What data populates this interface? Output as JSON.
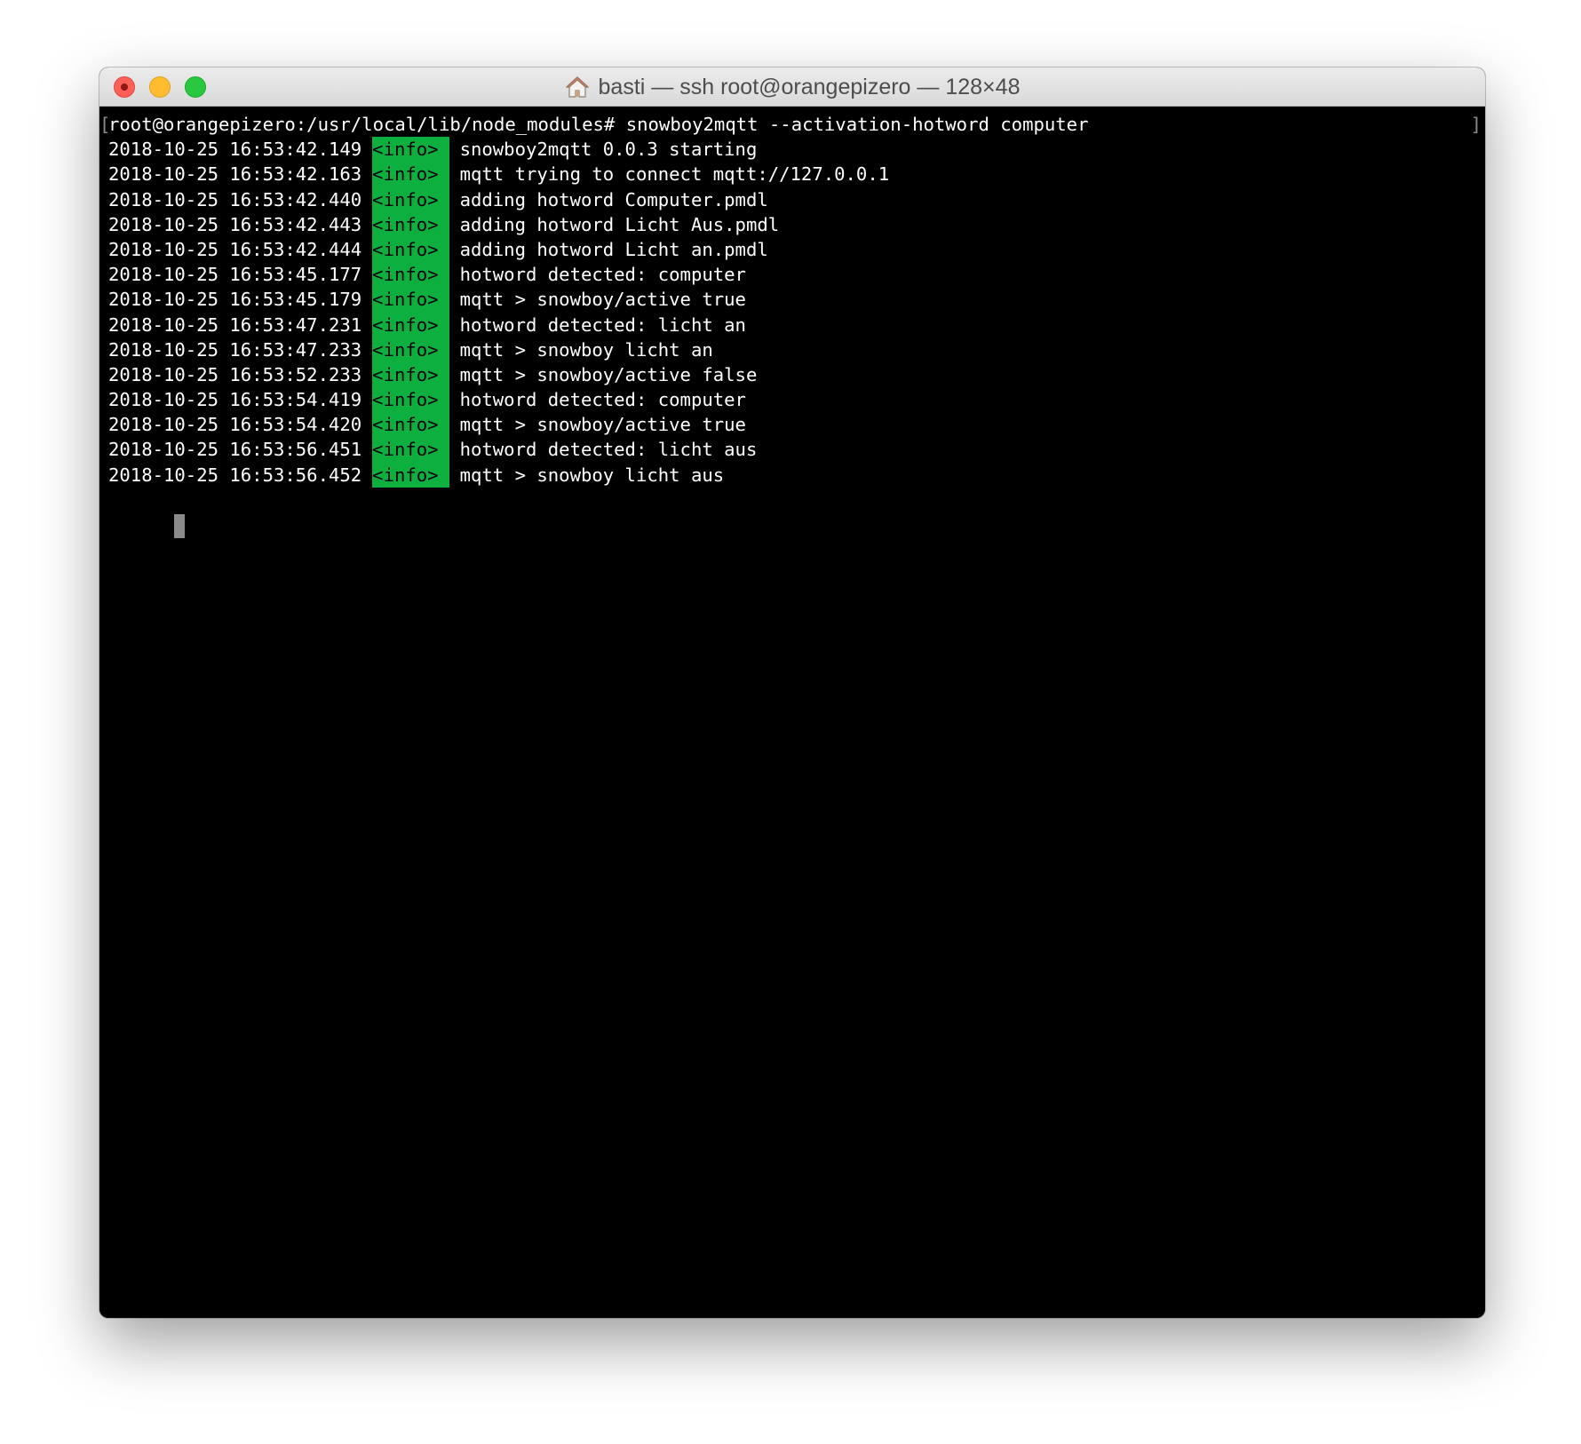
{
  "window": {
    "title": "basti — ssh root@orangepizero — 128×48"
  },
  "terminal": {
    "prompt": "root@orangepizero:/usr/local/lib/node_modules# snowboy2mqtt --activation-hotword computer",
    "bracket_left": "[",
    "bracket_right": "]",
    "lines": [
      {
        "ts": "2018-10-25 16:53:42.149",
        "level": "<info>",
        "msg": "snowboy2mqtt 0.0.3 starting"
      },
      {
        "ts": "2018-10-25 16:53:42.163",
        "level": "<info>",
        "msg": "mqtt trying to connect mqtt://127.0.0.1"
      },
      {
        "ts": "2018-10-25 16:53:42.440",
        "level": "<info>",
        "msg": "adding hotword Computer.pmdl"
      },
      {
        "ts": "2018-10-25 16:53:42.443",
        "level": "<info>",
        "msg": "adding hotword Licht Aus.pmdl"
      },
      {
        "ts": "2018-10-25 16:53:42.444",
        "level": "<info>",
        "msg": "adding hotword Licht an.pmdl"
      },
      {
        "ts": "2018-10-25 16:53:45.177",
        "level": "<info>",
        "msg": "hotword detected: computer"
      },
      {
        "ts": "2018-10-25 16:53:45.179",
        "level": "<info>",
        "msg": "mqtt > snowboy/active true"
      },
      {
        "ts": "2018-10-25 16:53:47.231",
        "level": "<info>",
        "msg": "hotword detected: licht an"
      },
      {
        "ts": "2018-10-25 16:53:47.233",
        "level": "<info>",
        "msg": "mqtt > snowboy licht an"
      },
      {
        "ts": "2018-10-25 16:53:52.233",
        "level": "<info>",
        "msg": "mqtt > snowboy/active false"
      },
      {
        "ts": "2018-10-25 16:53:54.419",
        "level": "<info>",
        "msg": "hotword detected: computer"
      },
      {
        "ts": "2018-10-25 16:53:54.420",
        "level": "<info>",
        "msg": "mqtt > snowboy/active true"
      },
      {
        "ts": "2018-10-25 16:53:56.451",
        "level": "<info>",
        "msg": "hotword detected: licht aus"
      },
      {
        "ts": "2018-10-25 16:53:56.452",
        "level": "<info>",
        "msg": "mqtt > snowboy licht aus"
      }
    ]
  },
  "colors": {
    "info_badge_bg": "#0db03e",
    "terminal_bg": "#000000",
    "terminal_fg": "#ffffff"
  },
  "icons": {
    "close": "close-icon",
    "minimize": "minimize-icon",
    "maximize": "maximize-icon",
    "title": "home-icon"
  }
}
